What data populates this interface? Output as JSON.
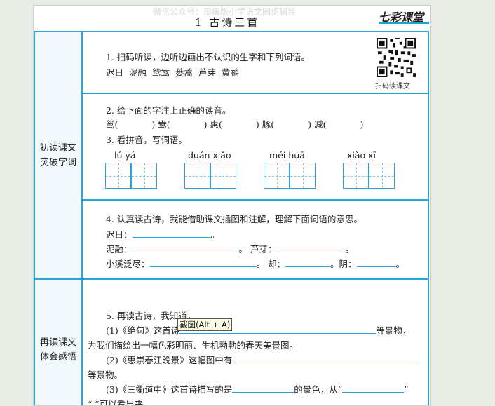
{
  "header": {
    "watermark": "微信公众号：部编版小学语文同步辅导",
    "title": "1  古诗三首",
    "logo": "七彩课堂"
  },
  "sections": {
    "section1_label": "初读课文\n突破字词",
    "section2_label": "再读课文\n体会感悟"
  },
  "q1": {
    "text": "1. 扫码听读，边听边画出不认识的生字和下列词语。",
    "words": "迟日    泥融    鸳鸯    蒌蒿    芦芽    黄鹂",
    "qr_label": "扫码读课文"
  },
  "q2": {
    "text": "2. 给下面的字注上正确的读音。",
    "chars": [
      "鸳(",
      ")",
      "鸯(",
      ")",
      "惠(",
      ")",
      "豚(",
      ")",
      "减(",
      ")"
    ]
  },
  "q3": {
    "text": "3. 看拼音，写词语。",
    "pinyin": [
      "lú   yá",
      "duǎn  xiǎo",
      "méi   huā",
      "xiǎo   xī"
    ]
  },
  "q4": {
    "text": "4. 认真读古诗，我能借助课文插图和注解，理解下面词语的意思。",
    "l1": "迟日：",
    "l1_end": "。",
    "l2a": "泥融：",
    "l2b": "。  芦芽：",
    "l2_end": "。",
    "l3a": "小溪泛尽：",
    "l3b": "。  却：",
    "l3c": "。阴：",
    "l3_end": "。"
  },
  "q5": {
    "text": "5. 再读古诗，我知道，",
    "p1a": "(1)《绝句》这首诗",
    "p1_end": "等景物，",
    "p1b": "为我们描绘出一幅色彩明丽、生机勃勃的春天美景图。",
    "p2a": "(2)《惠崇春江晚景》这幅图中有",
    "p2b": "等景物。",
    "p3a": "(3)《三衢道中》这首诗描写的是",
    "p3b": "的景色，从“",
    "p3c": "”",
    "p4": "“            ”可以看出来"
  },
  "tooltip": "截图(Alt + A)"
}
